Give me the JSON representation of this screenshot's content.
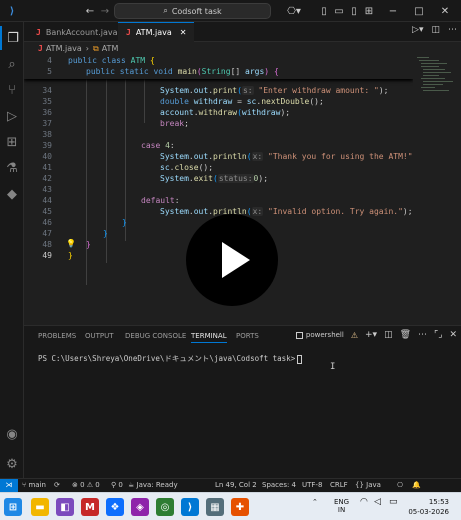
{
  "window": {
    "search_text": "Codsoft task"
  },
  "tabs": [
    {
      "label": "BankAccount.java",
      "lang_glyph": "J"
    },
    {
      "label": "ATM.java",
      "lang_glyph": "J"
    }
  ],
  "breadcrumb": {
    "file": "ATM.java",
    "symbol": "ATM"
  },
  "sticky": [
    {
      "ln": "4",
      "text": "public class ATM {"
    },
    {
      "ln": "5",
      "text": "public static void main(String[] args) {"
    }
  ],
  "code": {
    "line_numbers": [
      "34",
      "35",
      "36",
      "37",
      "38",
      "39",
      "40",
      "41",
      "42",
      "43",
      "44",
      "45",
      "46",
      "47",
      "48",
      "49"
    ],
    "l34": {
      "obj": "System",
      "dot1": ".",
      "out": "out",
      "dot2": ".",
      "fn": "print",
      "hint": "s:",
      "str": "\"Enter withdraw amount: \"",
      "end": ");"
    },
    "l35": {
      "type": "double",
      "var": "withdraw",
      "eq": " = ",
      "obj": "sc",
      "fn": "nextDouble",
      "end": "();"
    },
    "l36": {
      "obj": "account",
      "fn": "withdraw",
      "arg": "withdraw",
      "end": ");"
    },
    "l37": {
      "kw": "break",
      "end": ";"
    },
    "l39": {
      "kw": "case",
      "num": "4",
      "end": ":"
    },
    "l40": {
      "obj": "System",
      "out": "out",
      "fn": "println",
      "hint": "x:",
      "str": "\"Thank you for using the ATM!\"",
      "end": ");"
    },
    "l41": {
      "obj": "sc",
      "fn": "close",
      "end": "();"
    },
    "l42": {
      "obj": "System",
      "fn": "exit",
      "hint": "status:",
      "num": "0",
      "end": ");"
    },
    "l44": {
      "kw": "default",
      "end": ":"
    },
    "l45": {
      "obj": "System",
      "out": "out",
      "fn": "println",
      "hint": "x:",
      "str": "\"Invalid option. Try again.\"",
      "end": ");"
    },
    "l46": {
      "brace": "}"
    },
    "l47": {
      "brace": "}"
    },
    "l48": {
      "brace": "}"
    },
    "l49": {
      "brace": "}"
    }
  },
  "panel": {
    "tabs": [
      "PROBLEMS",
      "OUTPUT",
      "DEBUG CONSOLE",
      "TERMINAL",
      "PORTS"
    ],
    "active_tab": "TERMINAL",
    "shell": "powershell",
    "prompt": "PS C:\\Users\\Shreya\\OneDrive\\ドキュメント\\java\\Codsoft task>"
  },
  "status": {
    "branch": "main",
    "errors": "0",
    "warnings": "0",
    "ports": "0",
    "java": "Java: Ready",
    "position": "Ln 49, Col 2",
    "spaces": "Spaces: 4",
    "encoding": "UTF-8",
    "eol": "CRLF",
    "lang": "{} Java"
  },
  "taskbar": {
    "lang_top": "ENG",
    "lang_bottom": "IN",
    "time": "15:53",
    "date": "05-03-2026"
  },
  "colors": {
    "accent": "#0078d4",
    "editor_bg": "#1f1f1f",
    "keyword": "#569cd6",
    "string": "#ce9178",
    "function": "#dcdcaa"
  }
}
